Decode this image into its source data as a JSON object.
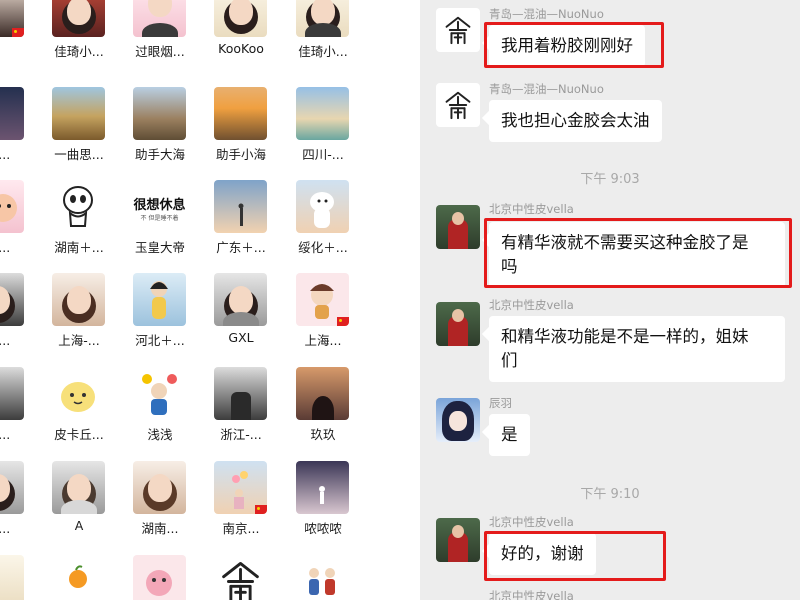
{
  "members": [
    {
      "name": "",
      "flag": true
    },
    {
      "name": "佳琦小..."
    },
    {
      "name": "过眼烟..."
    },
    {
      "name": "KooKoo"
    },
    {
      "name": "佳琦小..."
    },
    {
      "name": "人..."
    },
    {
      "name": "一曲思..."
    },
    {
      "name": "助手大海"
    },
    {
      "name": "助手小海"
    },
    {
      "name": "四川-..."
    },
    {
      "name": "东..."
    },
    {
      "name": "湖南＋..."
    },
    {
      "name": "玉皇大帝",
      "text_avatar": {
        "title": "很想休息",
        "subtitle": "不 但是睡不着"
      }
    },
    {
      "name": "广东＋..."
    },
    {
      "name": "绥化＋..."
    },
    {
      "name": "＋..."
    },
    {
      "name": "上海-..."
    },
    {
      "name": "河北＋..."
    },
    {
      "name": "GXL"
    },
    {
      "name": "上海..."
    },
    {
      "name": "干..."
    },
    {
      "name": "皮卡丘..."
    },
    {
      "name": "浅浅"
    },
    {
      "name": "浙江-..."
    },
    {
      "name": "玖玖"
    },
    {
      "name": "气..."
    },
    {
      "name": "A"
    },
    {
      "name": "湖南..."
    },
    {
      "name": "南京..."
    },
    {
      "name": "哝哝哝"
    },
    {
      "name": ""
    },
    {
      "name": ""
    },
    {
      "name": ""
    },
    {
      "name": ""
    },
    {
      "name": ""
    }
  ],
  "chat": {
    "messages": [
      {
        "sender": "青岛—混油—NuoNuo",
        "text": "我用着粉胶刚刚好",
        "highlighted": true
      },
      {
        "sender": "青岛—混油—NuoNuo",
        "text": "我也担心金胶会太油"
      },
      {
        "time": "下午 9:03"
      },
      {
        "sender": "北京中性皮vella",
        "text_line1": "有精华液就不需要买这种金胶了是",
        "text_line2": "吗",
        "highlighted": true
      },
      {
        "sender": "北京中性皮vella",
        "text_line1": "和精华液功能是不是一样的，姐妹",
        "text_line2": "们"
      },
      {
        "sender": "辰羽",
        "text": "是"
      },
      {
        "time": "下午 9:10"
      },
      {
        "sender": "北京中性皮vella",
        "text": "好的，谢谢",
        "highlighted": true
      },
      {
        "sender": "北京中性皮vella"
      }
    ]
  },
  "colors": {
    "highlight": "#e41b1b",
    "chat_bg": "#ededed",
    "bubble": "#ffffff",
    "timestamp": "#a8a8a8"
  }
}
